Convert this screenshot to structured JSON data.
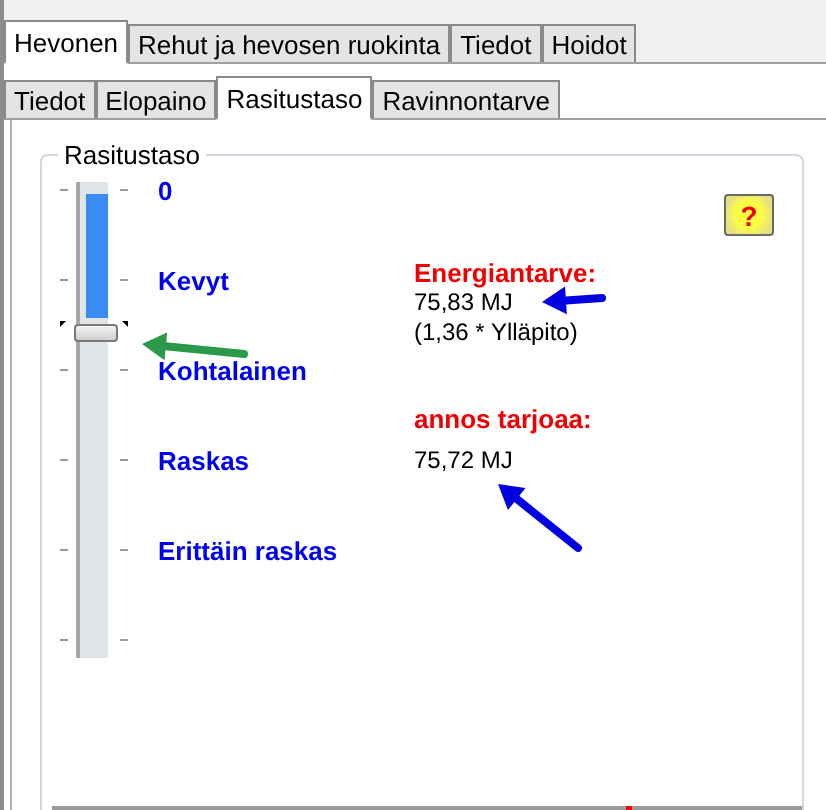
{
  "main_tabs": [
    {
      "label": "Hevonen",
      "selected": true
    },
    {
      "label": "Rehut ja hevosen ruokinta",
      "selected": false
    },
    {
      "label": "Tiedot",
      "selected": false
    },
    {
      "label": "Hoidot",
      "selected": false
    }
  ],
  "sub_tabs": [
    {
      "label": "Tiedot",
      "selected": false
    },
    {
      "label": "Elopaino",
      "selected": false
    },
    {
      "label": "Rasitustaso",
      "selected": true
    },
    {
      "label": "Ravinnontarve",
      "selected": false
    }
  ],
  "group": {
    "title": "Rasitustaso",
    "slider": {
      "level": 0.29,
      "labels": [
        "0",
        "Kevyt",
        "Kohtalainen",
        "Raskas",
        "Erittäin raskas"
      ]
    },
    "help_button": {
      "label": "?"
    },
    "energy_need": {
      "heading": "Energiantarve:",
      "value": "75,83 MJ",
      "note": "(1,36 * Ylläpito)"
    },
    "ration": {
      "heading": "annos tarjoaa:",
      "value": "75,72 MJ"
    }
  }
}
